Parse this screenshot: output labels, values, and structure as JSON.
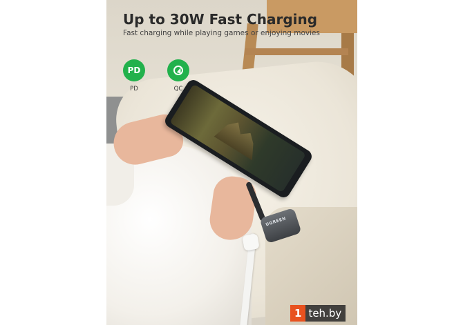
{
  "headline": "Up to 30W Fast Charging",
  "subheadline": "Fast charging while playing games or enjoying movies",
  "badges": [
    {
      "symbol": "PD",
      "label": "PD",
      "color": "#22b14c",
      "icon": "pd-badge-icon"
    },
    {
      "symbol": "",
      "label": "QC",
      "color": "#22b14c",
      "icon": "quick-charge-icon"
    }
  ],
  "adapter_brand": "UGREEN",
  "watermark": {
    "first": "1",
    "rest": "teh.by",
    "color": "#e8521f"
  }
}
